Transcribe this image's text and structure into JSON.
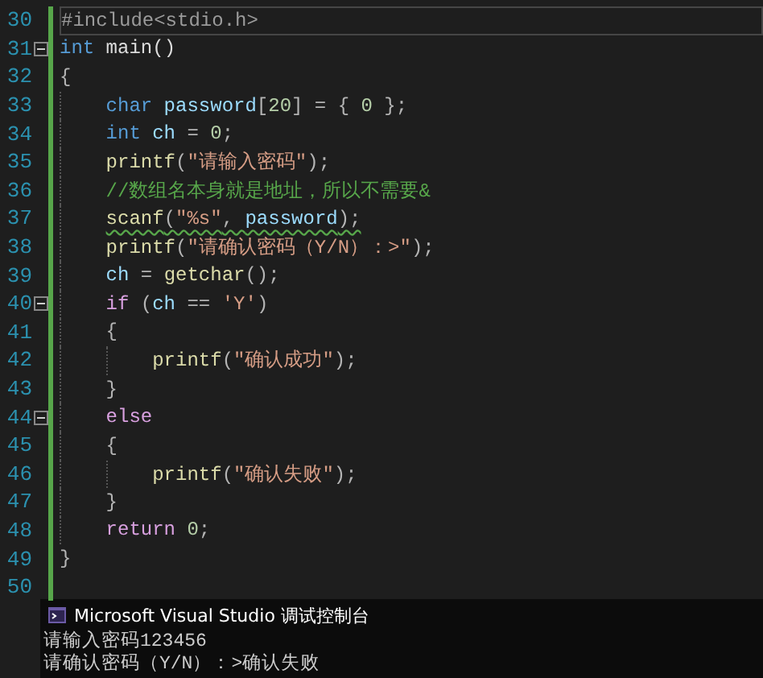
{
  "editor": {
    "lines": [
      {
        "number": "30",
        "fold": false,
        "current": true,
        "warning": false,
        "tokens": [
          {
            "kind": "preproc",
            "text": "#include<stdio.h>"
          }
        ]
      },
      {
        "number": "31",
        "fold": true,
        "current": false,
        "warning": false,
        "tokens": [
          {
            "kind": "keyword",
            "text": "int"
          },
          {
            "kind": "plain",
            "text": " main()"
          }
        ]
      },
      {
        "number": "32",
        "fold": false,
        "current": false,
        "warning": false,
        "tokens": [
          {
            "kind": "punct",
            "text": "{"
          }
        ],
        "children": [
          {
            "number": "33",
            "fold": false,
            "current": false,
            "warning": false,
            "tokens": [
              {
                "kind": "keyword",
                "text": "char"
              },
              {
                "kind": "ident",
                "text": " password"
              },
              {
                "kind": "punct",
                "text": "["
              },
              {
                "kind": "number",
                "text": "20"
              },
              {
                "kind": "punct",
                "text": "] = { "
              },
              {
                "kind": "number",
                "text": "0"
              },
              {
                "kind": "punct",
                "text": " };"
              }
            ]
          },
          {
            "number": "34",
            "fold": false,
            "current": false,
            "warning": false,
            "tokens": [
              {
                "kind": "keyword",
                "text": "int"
              },
              {
                "kind": "ident",
                "text": " ch"
              },
              {
                "kind": "punct",
                "text": " = "
              },
              {
                "kind": "number",
                "text": "0"
              },
              {
                "kind": "punct",
                "text": ";"
              }
            ]
          },
          {
            "number": "35",
            "fold": false,
            "current": false,
            "warning": false,
            "tokens": [
              {
                "kind": "func",
                "text": "printf"
              },
              {
                "kind": "punct",
                "text": "("
              },
              {
                "kind": "string",
                "text": "\"请输入密码\""
              },
              {
                "kind": "punct",
                "text": ");"
              }
            ]
          },
          {
            "number": "36",
            "fold": false,
            "current": false,
            "warning": false,
            "tokens": [
              {
                "kind": "comment",
                "text": "//数组名本身就是地址，所以不需要&"
              }
            ]
          },
          {
            "number": "37",
            "fold": false,
            "current": false,
            "warning": true,
            "tokens": [
              {
                "kind": "func",
                "text": "scanf"
              },
              {
                "kind": "punct",
                "text": "("
              },
              {
                "kind": "string",
                "text": "\"%s\""
              },
              {
                "kind": "punct",
                "text": ", "
              },
              {
                "kind": "ident",
                "text": "password"
              },
              {
                "kind": "punct",
                "text": ");"
              }
            ]
          },
          {
            "number": "38",
            "fold": false,
            "current": false,
            "warning": false,
            "tokens": [
              {
                "kind": "func",
                "text": "printf"
              },
              {
                "kind": "punct",
                "text": "("
              },
              {
                "kind": "string",
                "text": "\"请确认密码（Y/N）：>\""
              },
              {
                "kind": "punct",
                "text": ");"
              }
            ]
          },
          {
            "number": "39",
            "fold": false,
            "current": false,
            "warning": false,
            "tokens": [
              {
                "kind": "ident",
                "text": "ch"
              },
              {
                "kind": "punct",
                "text": " = "
              },
              {
                "kind": "func",
                "text": "getchar"
              },
              {
                "kind": "punct",
                "text": "();"
              }
            ]
          },
          {
            "number": "40",
            "fold": true,
            "current": false,
            "warning": false,
            "tokens": [
              {
                "kind": "control",
                "text": "if"
              },
              {
                "kind": "punct",
                "text": " ("
              },
              {
                "kind": "ident",
                "text": "ch"
              },
              {
                "kind": "punct",
                "text": " == "
              },
              {
                "kind": "string",
                "text": "'Y'"
              },
              {
                "kind": "punct",
                "text": ")"
              }
            ]
          },
          {
            "number": "41",
            "fold": false,
            "current": false,
            "warning": false,
            "tokens": [
              {
                "kind": "punct",
                "text": "{"
              }
            ],
            "children": [
              {
                "number": "42",
                "fold": false,
                "current": false,
                "warning": false,
                "tokens": [
                  {
                    "kind": "func",
                    "text": "printf"
                  },
                  {
                    "kind": "punct",
                    "text": "("
                  },
                  {
                    "kind": "string",
                    "text": "\"确认成功\""
                  },
                  {
                    "kind": "punct",
                    "text": ");"
                  }
                ]
              }
            ]
          },
          {
            "number": "43",
            "fold": false,
            "current": false,
            "warning": false,
            "tokens": [
              {
                "kind": "punct",
                "text": "}"
              }
            ]
          },
          {
            "number": "44",
            "fold": true,
            "current": false,
            "warning": false,
            "tokens": [
              {
                "kind": "control",
                "text": "else"
              }
            ]
          },
          {
            "number": "45",
            "fold": false,
            "current": false,
            "warning": false,
            "tokens": [
              {
                "kind": "punct",
                "text": "{"
              }
            ],
            "children": [
              {
                "number": "46",
                "fold": false,
                "current": false,
                "warning": false,
                "tokens": [
                  {
                    "kind": "func",
                    "text": "printf"
                  },
                  {
                    "kind": "punct",
                    "text": "("
                  },
                  {
                    "kind": "string",
                    "text": "\"确认失败\""
                  },
                  {
                    "kind": "punct",
                    "text": ");"
                  }
                ]
              }
            ]
          },
          {
            "number": "47",
            "fold": false,
            "current": false,
            "warning": false,
            "tokens": [
              {
                "kind": "punct",
                "text": "}"
              }
            ]
          },
          {
            "number": "48",
            "fold": false,
            "current": false,
            "warning": false,
            "tokens": [
              {
                "kind": "control",
                "text": "return"
              },
              {
                "kind": "number",
                "text": " 0"
              },
              {
                "kind": "punct",
                "text": ";"
              }
            ]
          }
        ]
      },
      {
        "number": "49",
        "fold": false,
        "current": false,
        "warning": false,
        "tokens": [
          {
            "kind": "punct",
            "text": "}"
          }
        ]
      },
      {
        "number": "50",
        "fold": false,
        "current": false,
        "warning": false
      }
    ]
  },
  "console": {
    "title": "Microsoft Visual Studio 调试控制台",
    "output": [
      "请输入密码123456",
      "请确认密码（Y/N）：>确认失败"
    ]
  }
}
